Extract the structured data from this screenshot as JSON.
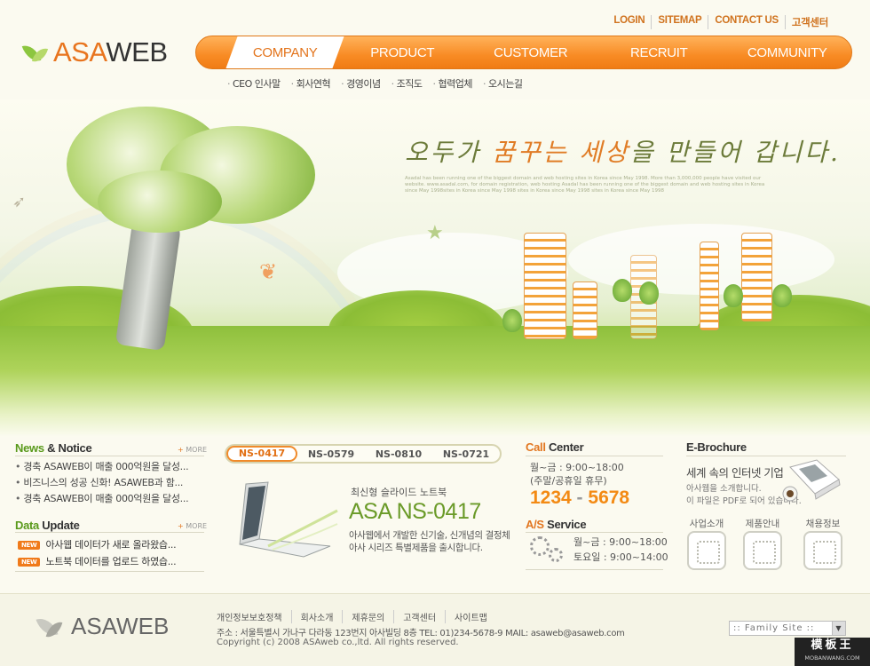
{
  "header": {
    "brand_prefix": "ASA",
    "brand_suffix": "WEB",
    "util_links": [
      "LOGIN",
      "SITEMAP",
      "CONTACT US",
      "고객센터"
    ],
    "nav": [
      "COMPANY",
      "PRODUCT",
      "CUSTOMER",
      "RECRUIT",
      "COMMUNITY"
    ],
    "subnav": [
      "CEO 인사말",
      "회사연혁",
      "경영이념",
      "조직도",
      "협력업체",
      "오시는길"
    ]
  },
  "visual": {
    "slogan_a": "오두가 ",
    "slogan_b": "꿈꾸는",
    "slogan_c": " 세상",
    "slogan_d": "을 만들어 갑니다.",
    "slogan_sub": "Asadal has been running one of the biggest domain and web hosting sites in Korea since May 1998. More than 3,000,000 people have visited our website. www.asadal.com, for domain registration, web hosting Asadal has been running one of the biggest domain and web hosting sites in Korea since May 1998sites in Korea since May 1998 sites in Korea since May 1998 sites in Korea since May 1998"
  },
  "news": {
    "title_a": "News",
    "title_amp": " & ",
    "title_b": "Notice",
    "more": "MORE",
    "items": [
      "경축 ASAWEB이 매출 000억원을 달성...",
      "비즈니스의 성공 신화! ASAWEB과 함...",
      "경축 ASAWEB이 매출 000억원을 달성..."
    ]
  },
  "data_update": {
    "title_a": "Data",
    "title_b": " Update",
    "more": "MORE",
    "badge": "NEW",
    "items": [
      "아사웹 데이터가 새로 올라왔습...",
      "노트북 데이터를 업로드 하였습..."
    ]
  },
  "product": {
    "tabs": [
      "NS-0417",
      "NS-0579",
      "NS-0810",
      "NS-0721"
    ],
    "subtitle": "최신형 슬라이드 노트북",
    "name": "ASA NS-0417",
    "desc1": "아사웹에서 개발한 신기술, 신개념의 결정체",
    "desc2": "아사 시리즈 특별제품을 출시합니다."
  },
  "call": {
    "title_a": "Call",
    "title_b": " Center",
    "hours1": "월~금 : 9:00~18:00",
    "hours2": "(주말/공휴일 휴무)",
    "phone_a": "1234",
    "phone_sep": " - ",
    "phone_b": "5678"
  },
  "service": {
    "title_a": "A/S",
    "title_b": " Service",
    "hours1": "월~금 : 9:00~18:00",
    "hours2": "토요일 : 9:00~14:00"
  },
  "ebrochure": {
    "title": "E-Brochure",
    "headline": "세계 속의 인터넷 기업",
    "desc1": "아사웹을 소개합니다.",
    "desc2": "이 파일은 PDF로 되어 있습니다.",
    "buttons": [
      "사업소개",
      "제품안내",
      "채용정보"
    ]
  },
  "footer": {
    "brand": "ASAWEB",
    "links": [
      "개인정보보호정책",
      "회사소개",
      "제휴문의",
      "고객센터",
      "사이트맵"
    ],
    "address": "주소 : 서울특별시 가나구 다라동 123번지 아사빌딩 8층  TEL: 01)234-5678-9 MAIL: asaweb@asaweb.com",
    "copyright": "Copyright (c) 2008 ASAweb  co.,ltd. All rights reserved.",
    "family_site": ":: Family Site ::",
    "family_arrow": "▼",
    "mark_title": "模板王",
    "mark_url": "MOBANWANG.COM"
  }
}
